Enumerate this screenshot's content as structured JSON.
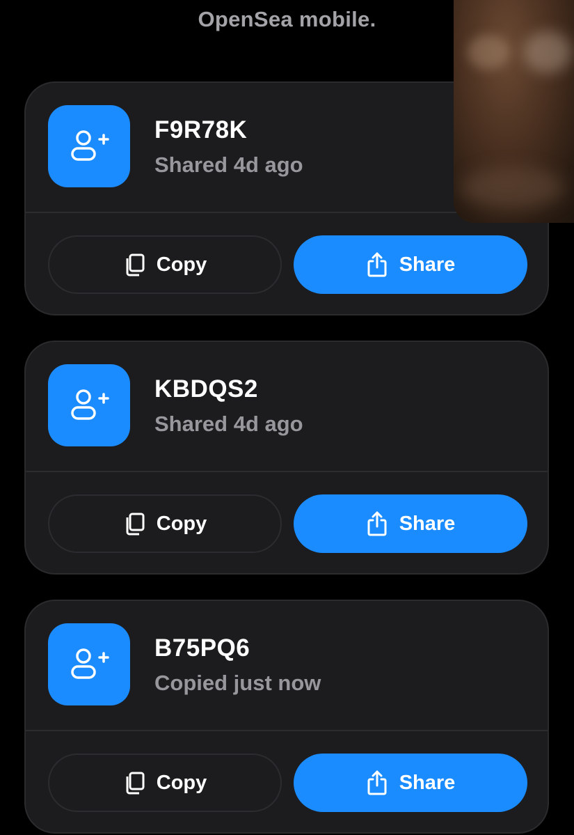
{
  "header": {
    "intro_text": "OpenSea mobile."
  },
  "invites": [
    {
      "code": "F9R78K",
      "status": "Shared 4d ago",
      "copy_label": "Copy",
      "share_label": "Share"
    },
    {
      "code": "KBDQS2",
      "status": "Shared 4d ago",
      "copy_label": "Copy",
      "share_label": "Share"
    },
    {
      "code": "B75PQ6",
      "status": "Copied just now",
      "copy_label": "Copy",
      "share_label": "Share"
    }
  ],
  "icons": {
    "invite": "add-user-icon",
    "copy": "copy-icon",
    "share": "share-icon"
  },
  "colors": {
    "background": "#000000",
    "card": "#1c1c1e",
    "accent": "#1a8cff",
    "secondary_text": "#97979c"
  }
}
